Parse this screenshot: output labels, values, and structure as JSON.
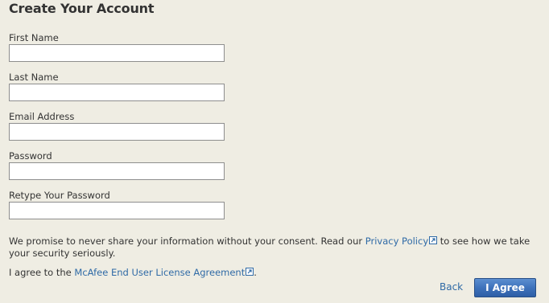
{
  "page": {
    "title": "Create Your Account"
  },
  "form": {
    "first_name": {
      "label": "First Name",
      "value": ""
    },
    "last_name": {
      "label": "Last Name",
      "value": ""
    },
    "email": {
      "label": "Email Address",
      "value": ""
    },
    "password": {
      "label": "Password",
      "value": ""
    },
    "retype_password": {
      "label": "Retype Your Password",
      "value": ""
    }
  },
  "privacy": {
    "text_before": "We promise to never share your information without your consent. Read our ",
    "link": "Privacy Policy",
    "text_after": " to see how we take your security seriously."
  },
  "agreement": {
    "text_before": "I agree to the ",
    "link": "McAfee End User License Agreement",
    "text_after": "."
  },
  "actions": {
    "back": "Back",
    "agree": "I Agree"
  },
  "colors": {
    "background": "#efede3",
    "link": "#2f6aa6",
    "button": "#3e72bb"
  },
  "icons": {
    "external_link": "external-link-icon"
  }
}
